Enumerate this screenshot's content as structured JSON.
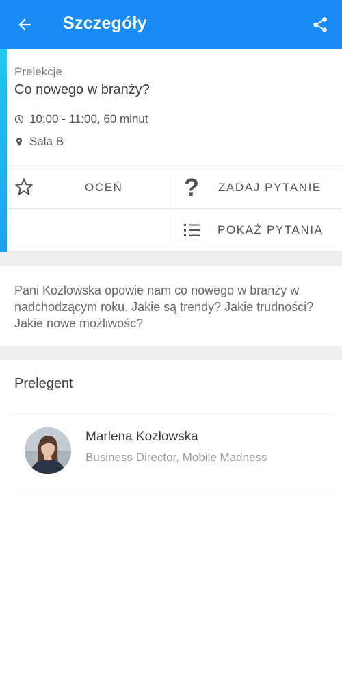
{
  "appbar": {
    "title": "Szczegóły",
    "back_icon": "arrow-left-icon",
    "share_icon": "share-icon",
    "color": "#1a8bf5"
  },
  "session": {
    "category": "Prelekcje",
    "title": "Co nowego w branży?",
    "time": "10:00 - 11:00, 60 minut",
    "room": "Sala B",
    "accent_color": "#1aa2f0"
  },
  "actions": {
    "rate": "OCEŃ",
    "ask": "ZADAJ PYTANIE",
    "show_questions": "POKAŻ PYTANIA"
  },
  "description": "Pani Kozłowska opowie nam co nowego w branży w nadchodzącym roku. Jakie są trendy? Jakie trudności? Jakie nowe możliwośc?",
  "speakers": {
    "heading": "Prelegent",
    "items": [
      {
        "name": "Marlena Kozłowska",
        "role": "Business Director, Mobile Madness"
      }
    ]
  }
}
